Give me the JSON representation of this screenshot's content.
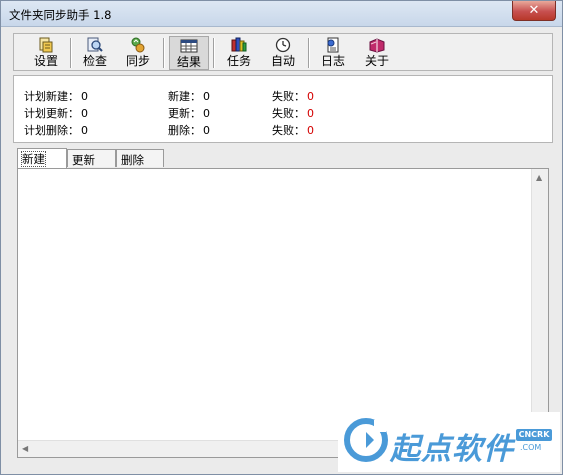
{
  "window": {
    "title": "文件夹同步助手 1.8",
    "close_glyph": "✕"
  },
  "toolbar": {
    "buttons": [
      {
        "label": "设置",
        "icon": "settings-icon"
      },
      {
        "label": "检查",
        "icon": "inspect-icon"
      },
      {
        "label": "同步",
        "icon": "sync-icon"
      },
      {
        "label": "结果",
        "icon": "results-icon",
        "active": true
      },
      {
        "label": "任务",
        "icon": "tasks-icon"
      },
      {
        "label": "自动",
        "icon": "clock-icon"
      },
      {
        "label": "日志",
        "icon": "log-icon"
      },
      {
        "label": "关于",
        "icon": "about-icon"
      }
    ]
  },
  "stats": {
    "planned_new_label": "计划新建：",
    "planned_new": "0",
    "planned_update_label": "计划更新：",
    "planned_update": "0",
    "planned_delete_label": "计划删除：",
    "planned_delete": "0",
    "new_label": "新建：",
    "new": "0",
    "update_label": "更新：",
    "update": "0",
    "delete_label": "删除：",
    "delete": "0",
    "fail_label": "失败：",
    "fail_new": "0",
    "fail_update": "0",
    "fail_delete": "0",
    "fail_color": "#d40000"
  },
  "tabs": [
    {
      "label": "新建",
      "active": true
    },
    {
      "label": "更新"
    },
    {
      "label": "删除"
    }
  ],
  "watermark": {
    "text": "起点软件",
    "badge": "CNCRK",
    "sub": ".COM"
  }
}
